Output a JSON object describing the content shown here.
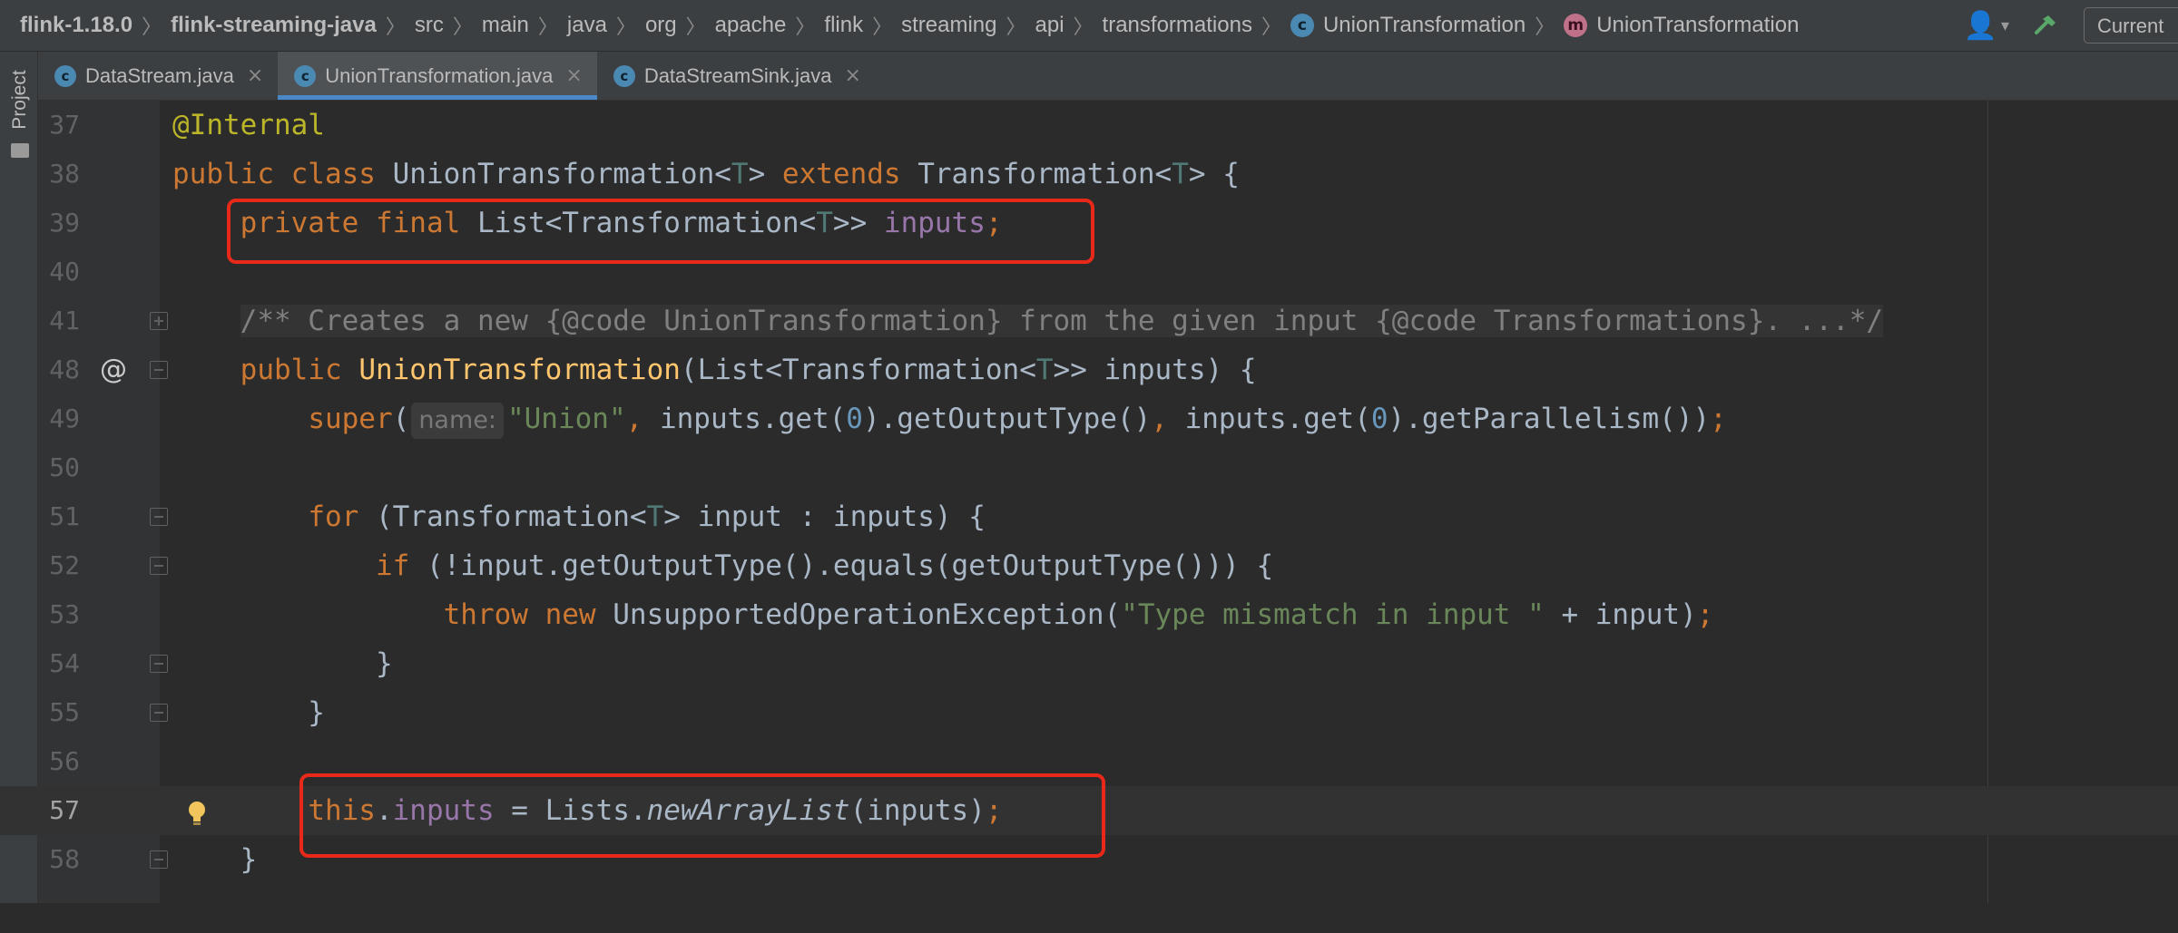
{
  "breadcrumb": [
    "flink-1.18.0",
    "flink-streaming-java",
    "src",
    "main",
    "java",
    "org",
    "apache",
    "flink",
    "streaming",
    "api",
    "transformations",
    "UnionTransformation",
    "UnionTransformation"
  ],
  "toolbar": {
    "current_label": "Current"
  },
  "sidebar": {
    "project_label": "Project"
  },
  "tabs": [
    {
      "label": "DataStream.java",
      "active": false
    },
    {
      "label": "UnionTransformation.java",
      "active": true
    },
    {
      "label": "DataStreamSink.java",
      "active": false
    }
  ],
  "editor": {
    "current_line": "57",
    "param_hint": "name:",
    "lines": [
      {
        "num": "37",
        "text": "@Internal"
      },
      {
        "num": "38",
        "text": "public class UnionTransformation<T> extends Transformation<T> {"
      },
      {
        "num": "39",
        "text": "    private final List<Transformation<T>> inputs;"
      },
      {
        "num": "40",
        "text": ""
      },
      {
        "num": "41",
        "text": "    /** Creates a new {@code UnionTransformation} from the given input {@code Transformations}. ...*/"
      },
      {
        "num": "48",
        "text": "    public UnionTransformation(List<Transformation<T>> inputs) {"
      },
      {
        "num": "49",
        "text": "        super(\"Union\", inputs.get(0).getOutputType(), inputs.get(0).getParallelism());"
      },
      {
        "num": "50",
        "text": ""
      },
      {
        "num": "51",
        "text": "        for (Transformation<T> input : inputs) {"
      },
      {
        "num": "52",
        "text": "            if (!input.getOutputType().equals(getOutputType())) {"
      },
      {
        "num": "53",
        "text": "                throw new UnsupportedOperationException(\"Type mismatch in input \" + input);"
      },
      {
        "num": "54",
        "text": "            }"
      },
      {
        "num": "55",
        "text": "        }"
      },
      {
        "num": "56",
        "text": ""
      },
      {
        "num": "57",
        "text": "        this.inputs = Lists.newArrayList(inputs);"
      },
      {
        "num": "58",
        "text": "    }"
      }
    ]
  },
  "colors": {
    "keyword": "#cc7832",
    "annotation": "#bbb529",
    "field": "#9876aa",
    "method_decl": "#ffc66d",
    "string": "#6a8759",
    "number": "#6897bb",
    "highlight_box": "#e8291a",
    "active_tab_underline": "#4a88c7"
  }
}
